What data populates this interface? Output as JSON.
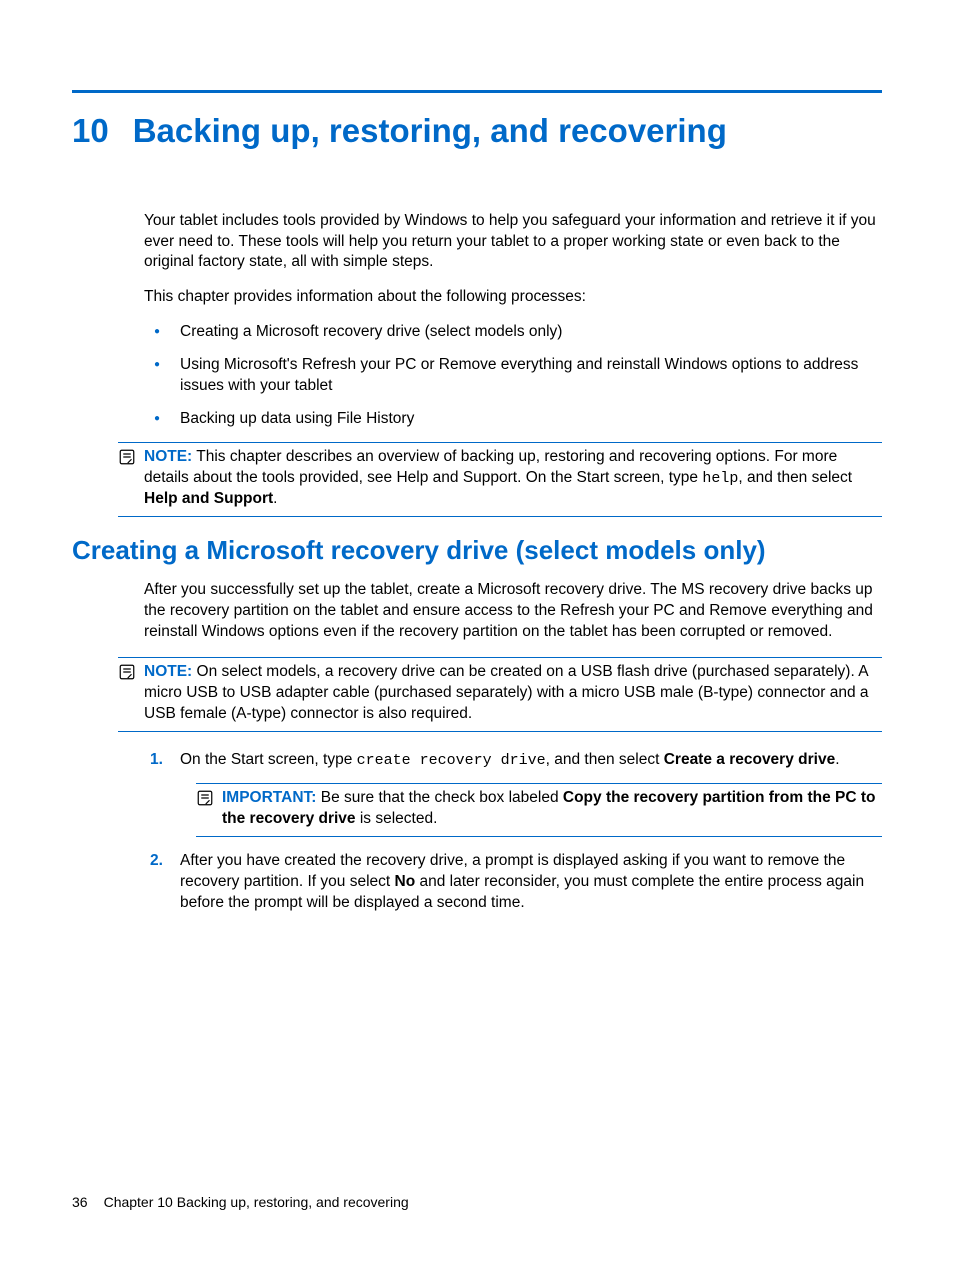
{
  "chapter": {
    "number": "10",
    "title": "Backing up, restoring, and recovering"
  },
  "intro": {
    "p1": "Your tablet includes tools provided by Windows to help you safeguard your information and retrieve it if you ever need to. These tools will help you return your tablet to a proper working state or even back to the original factory state, all with simple steps.",
    "p2": "This chapter provides information about the following processes:",
    "bullets": [
      "Creating a Microsoft recovery drive (select models only)",
      "Using Microsoft's Refresh your PC or Remove everything and reinstall Windows options to address issues with your tablet",
      "Backing up data using File History"
    ],
    "note": {
      "label": "NOTE:",
      "text_before_code": "This chapter describes an overview of backing up, restoring and recovering options. For more details about the tools provided, see Help and Support. On the Start screen, type ",
      "code": "help",
      "text_after_code": ", and then select ",
      "bold": "Help and Support",
      "tail": "."
    }
  },
  "section": {
    "heading": "Creating a Microsoft recovery drive (select models only)",
    "p1": "After you successfully set up the tablet, create a Microsoft recovery drive. The MS recovery drive backs up the recovery partition on the tablet and ensure access to the Refresh your PC and Remove everything and reinstall Windows options even if the recovery partition on the tablet has been corrupted or removed.",
    "note": {
      "label": "NOTE:",
      "text": "On select models, a recovery drive can be created on a USB flash drive (purchased separately). A micro USB to USB adapter cable (purchased separately) with a micro USB male (B-type) connector and a USB female (A-type) connector is also required."
    },
    "steps": {
      "s1": {
        "pre": "On the Start screen, type ",
        "code": "create recovery drive",
        "mid": ", and then select ",
        "bold": "Create a recovery drive",
        "tail": "."
      },
      "important": {
        "label": "IMPORTANT:",
        "pre": "Be sure that the check box labeled ",
        "bold": "Copy the recovery partition from the PC to the recovery drive",
        "tail": " is selected."
      },
      "s2": {
        "pre": "After you have created the recovery drive, a prompt is displayed asking if you want to remove the recovery partition. If you select ",
        "bold": "No",
        "tail": " and later reconsider, you must complete the entire process again before the prompt will be displayed a second time."
      }
    }
  },
  "footer": {
    "page": "36",
    "text": "Chapter 10   Backing up, restoring, and recovering"
  }
}
